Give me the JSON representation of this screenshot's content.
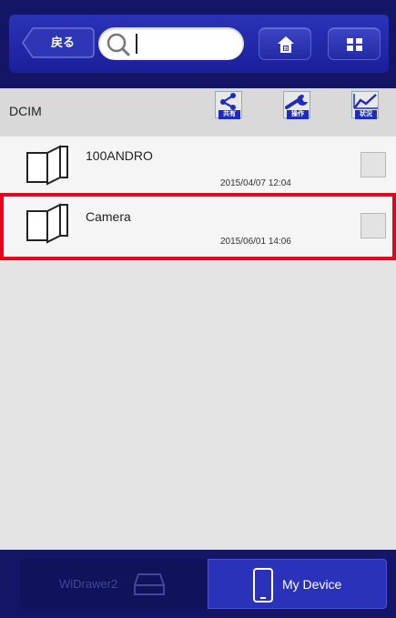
{
  "header": {
    "back_label": "戻る",
    "search": {
      "value": "",
      "placeholder": ""
    }
  },
  "path": {
    "current": "DCIM",
    "tools": [
      {
        "label": "共有",
        "icon": "share-icon"
      },
      {
        "label": "操作",
        "icon": "wrench-icon"
      },
      {
        "label": "状況",
        "icon": "chart-icon"
      }
    ]
  },
  "files": [
    {
      "name": "100ANDRO",
      "date": "2015/04/07 12:04",
      "icon": "folder-icon",
      "checked": false
    },
    {
      "name": "Camera",
      "date": "2015/06/01 14:06",
      "icon": "folder-icon",
      "checked": false,
      "highlighted": true
    }
  ],
  "bottom_tabs": {
    "left": {
      "label": "WiDrawer2",
      "icon": "drive-icon",
      "active": false
    },
    "right": {
      "label": "My Device",
      "icon": "phone-icon",
      "active": true
    }
  },
  "colors": {
    "header_bg": "#151565",
    "button_blue": "#2b32ba",
    "highlight_red": "#e8001c",
    "list_bg": "#e4e4e4"
  }
}
